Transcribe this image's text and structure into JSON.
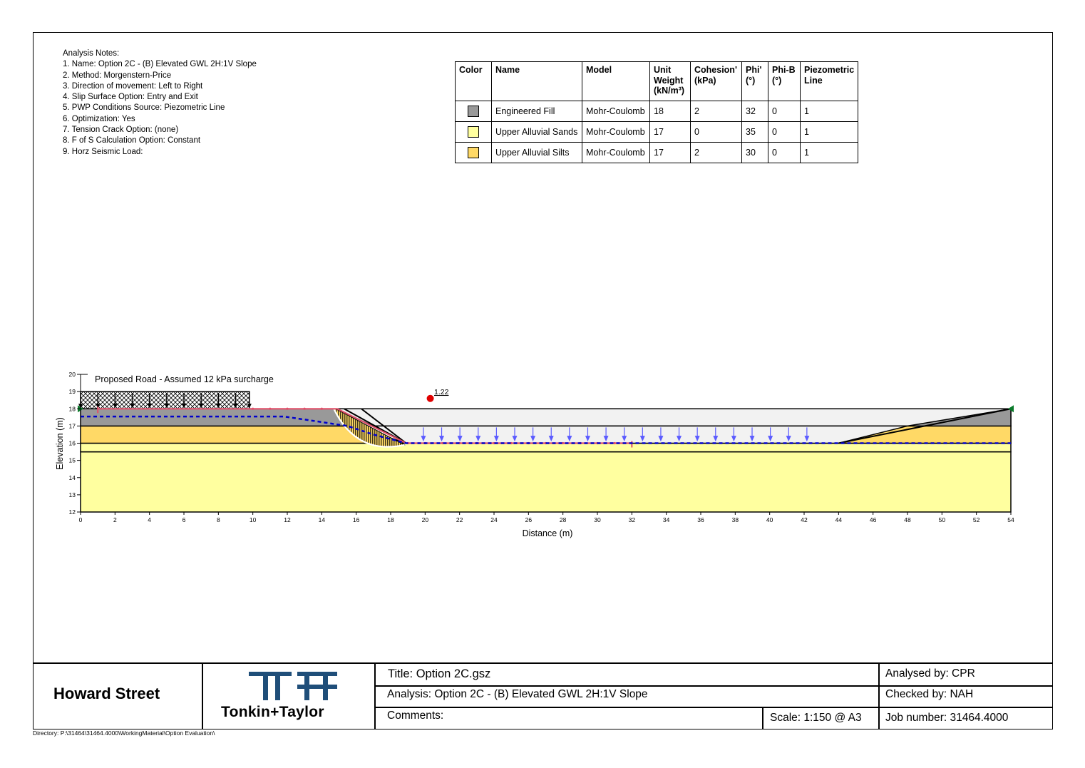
{
  "notes": {
    "heading": "Analysis Notes:",
    "items": [
      "1. Name: Option 2C - (B) Elevated GWL 2H:1V Slope",
      "2. Method: Morgenstern-Price",
      "3. Direction of movement: Left to Right",
      "4. Slip Surface Option: Entry and Exit",
      "5. PWP Conditions Source: Piezometric Line",
      "6. Optimization: Yes",
      "7. Tension Crack Option: (none)",
      "8. F of S Calculation Option: Constant",
      "9. Horz Seismic Load:"
    ]
  },
  "materials": {
    "headers": [
      "Color",
      "Name",
      "Model",
      "Unit Weight (kN/m³)",
      "Cohesion' (kPa)",
      "Phi' (°)",
      "Phi-B (°)",
      "Piezometric Line"
    ],
    "rows": [
      {
        "color": "#999999",
        "name": "Engineered Fill",
        "model": "Mohr-Coulomb",
        "unit_weight": "18",
        "cohesion": "2",
        "phi": "32",
        "phib": "0",
        "piezo": "1"
      },
      {
        "color": "#FFFF9F",
        "name": "Upper Alluvial Sands",
        "model": "Mohr-Coulomb",
        "unit_weight": "17",
        "cohesion": "0",
        "phi": "35",
        "phib": "0",
        "piezo": "1"
      },
      {
        "color": "#FFD966",
        "name": "Upper Alluvial Silts",
        "model": "Mohr-Coulomb",
        "unit_weight": "17",
        "cohesion": "2",
        "phi": "30",
        "phib": "0",
        "piezo": "1"
      }
    ]
  },
  "plot": {
    "surcharge_label": "Proposed Road - Assumed 12 kPa surcharge",
    "fos_label": "1.22",
    "xlabel": "Distance (m)",
    "ylabel": "Elevation (m)",
    "xlim": [
      0,
      54
    ],
    "ylim": [
      12,
      20
    ],
    "x_ticks": [
      0,
      2,
      4,
      6,
      8,
      10,
      12,
      14,
      16,
      18,
      20,
      22,
      24,
      26,
      28,
      30,
      32,
      34,
      36,
      38,
      40,
      42,
      44,
      46,
      48,
      50,
      52,
      54
    ],
    "y_ticks": [
      12,
      13,
      14,
      15,
      16,
      17,
      18,
      19,
      20
    ],
    "colors": {
      "fill": "#999999",
      "sand": "#FFFF9F",
      "silt": "#FFD966",
      "empty": "#F2F2F2",
      "water": "#0000CC",
      "load": "#5B5BFF",
      "slip": "#E0506A",
      "center": "#E00000"
    }
  },
  "title_block": {
    "project": "Howard Street",
    "logo_text": "Tonkin+Taylor",
    "title": "Title: Option 2C.gsz",
    "analysis": "Analysis: Option 2C - (B) Elevated GWL 2H:1V Slope",
    "comments": "Comments:",
    "scale": "Scale: 1:150 @ A3",
    "analysed_by": "Analysed by: CPR",
    "checked_by": "Checked by: NAH",
    "job_number": "Job number: 31464.4000",
    "logo_color": "#1F4E79"
  },
  "directory": "Directory: P:\\31464\\31464.4000\\WorkingMaterial\\Option Evaluation\\"
}
